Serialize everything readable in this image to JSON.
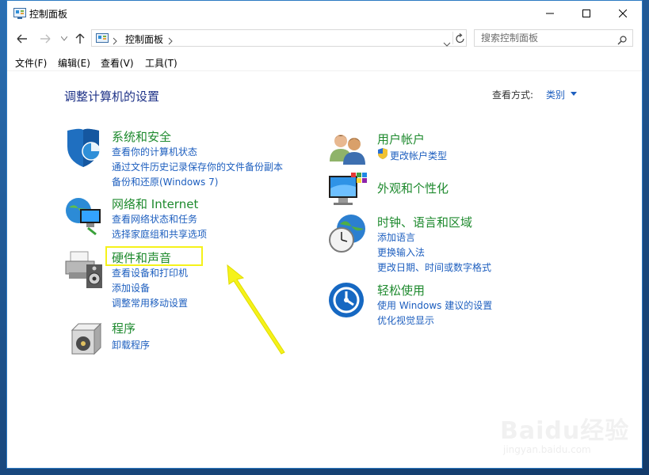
{
  "window": {
    "title": "控制面板",
    "minimize_glyph": "—",
    "maximize_glyph": "☐",
    "close_glyph": "✕"
  },
  "address": {
    "crumb": "控制面板",
    "search_placeholder": "搜索控制面板"
  },
  "menu": [
    "文件(F)",
    "编辑(E)",
    "查看(V)",
    "工具(T)"
  ],
  "page": {
    "title": "调整计算机的设置",
    "view_by_label": "查看方式:",
    "view_by_value": "类别"
  },
  "categories": [
    {
      "title": "系统和安全",
      "icon": "shield-icon",
      "links": [
        "查看你的计算机状态",
        "通过文件历史记录保存你的文件备份副本",
        "备份和还原(Windows 7)"
      ]
    },
    {
      "title": "网络和 Internet",
      "icon": "network-globe-icon",
      "links": [
        "查看网络状态和任务",
        "选择家庭组和共享选项"
      ]
    },
    {
      "title": "硬件和声音",
      "icon": "printer-speaker-icon",
      "links": [
        "查看设备和打印机",
        "添加设备",
        "调整常用移动设置"
      ]
    },
    {
      "title": "程序",
      "icon": "programs-icon",
      "links": [
        "卸载程序"
      ]
    },
    {
      "title": "用户帐户",
      "icon": "users-icon",
      "links": [
        "更改帐户类型"
      ]
    },
    {
      "title": "外观和个性化",
      "icon": "monitor-palette-icon",
      "links": []
    },
    {
      "title": "时钟、语言和区域",
      "icon": "clock-globe-icon",
      "links": [
        "添加语言",
        "更换输入法",
        "更改日期、时间或数字格式"
      ]
    },
    {
      "title": "轻松使用",
      "icon": "ease-of-access-icon",
      "links": [
        "使用 Windows 建议的设置",
        "优化视觉显示"
      ]
    }
  ],
  "watermark": {
    "brand": "Baidu经验",
    "url": "jingyan.baidu.com"
  }
}
